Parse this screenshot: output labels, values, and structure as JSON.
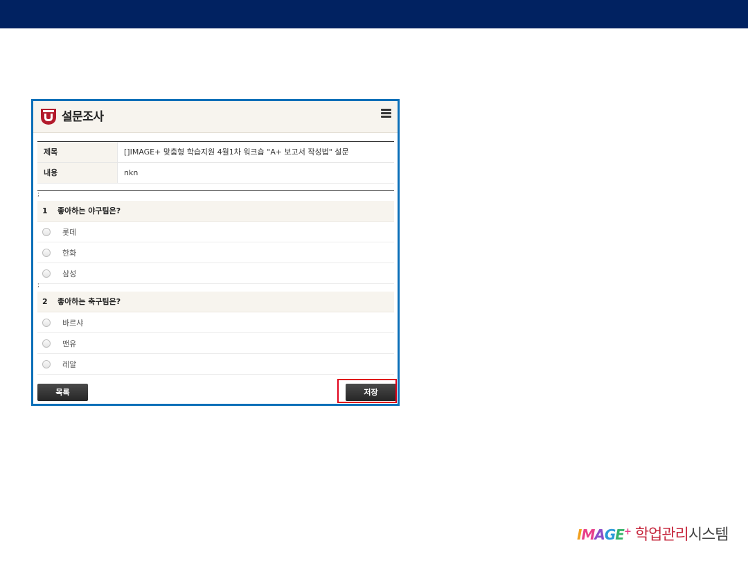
{
  "panel": {
    "title": "설문조사"
  },
  "info": {
    "subject_label": "제목",
    "subject_value": "[]IMAGE+ 맞춤형 학습지원 4월1차 워크숍 \"A+ 보고서 작성법\" 설문",
    "content_label": "내용",
    "content_value": "nkn"
  },
  "questions": [
    {
      "separator": ";",
      "number": "1",
      "text": "좋아하는 야구팀은?",
      "options": [
        "롯데",
        "한화",
        "삼성"
      ]
    },
    {
      "separator": ";",
      "number": "2",
      "text": "좋아하는 축구팀은?",
      "options": [
        "바르샤",
        "맨유",
        "레알"
      ]
    }
  ],
  "buttons": {
    "list": "목록",
    "save": "저장"
  },
  "brand": {
    "image_plus": "IMAGE+",
    "text_red": "학업관리",
    "text_dark": "시스템"
  },
  "colors": {
    "topbar": "#012261",
    "panel_border": "#0b6fb8",
    "highlight": "#e0001a",
    "brand_red": "#c6283e"
  }
}
